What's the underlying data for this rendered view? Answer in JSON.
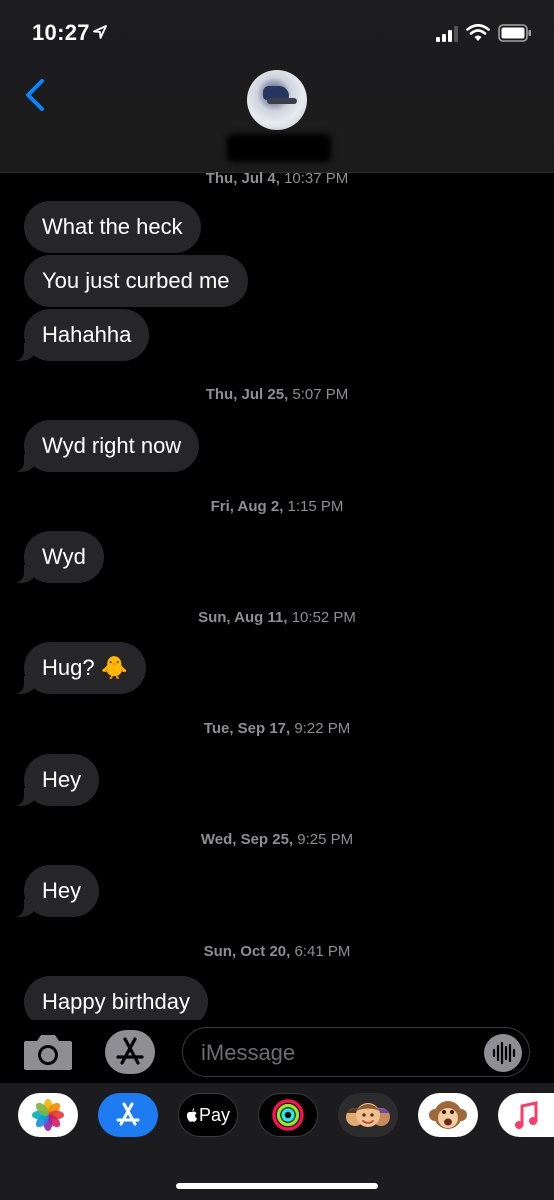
{
  "status_bar": {
    "time": "10:27",
    "icons": [
      "location-arrow-icon",
      "cellular-signal-icon",
      "wifi-icon",
      "battery-icon"
    ]
  },
  "header": {
    "back_icon": "chevron-left-icon",
    "avatar": "contact-avatar",
    "contact_name": ""
  },
  "thread": {
    "timestamp_top": {
      "day": "Thu, Jul 4,",
      "time": " 10:37 PM"
    },
    "messages": [
      {
        "text": "What the heck"
      },
      {
        "text": "You just curbed me"
      },
      {
        "text": "Hahahha"
      },
      {
        "timestamp": {
          "day": "Thu, Jul 25,",
          "time": " 5:07 PM"
        }
      },
      {
        "text": "Wyd right now"
      },
      {
        "timestamp": {
          "day": "Fri, Aug 2,",
          "time": " 1:15 PM"
        }
      },
      {
        "text": "Wyd"
      },
      {
        "timestamp": {
          "day": "Sun, Aug 11,",
          "time": " 10:52 PM"
        }
      },
      {
        "text": "Hug? 🐥"
      },
      {
        "timestamp": {
          "day": "Tue, Sep 17,",
          "time": " 9:22 PM"
        }
      },
      {
        "text": "Hey"
      },
      {
        "timestamp": {
          "day": "Wed, Sep 25,",
          "time": " 9:25 PM"
        }
      },
      {
        "text": "Hey"
      },
      {
        "timestamp": {
          "day": "Sun, Oct 20,",
          "time": " 6:41 PM"
        }
      },
      {
        "text": "Happy birthday"
      }
    ]
  },
  "composer": {
    "camera_icon": "camera-icon",
    "appstore_icon": "app-store-icon",
    "placeholder": "iMessage",
    "audio_icon": "audio-waveform-icon"
  },
  "app_drawer": {
    "apps": [
      {
        "name": "photos-app-icon",
        "label": ""
      },
      {
        "name": "app-store-app-icon",
        "label": ""
      },
      {
        "name": "apple-pay-app-icon",
        "label": "Pay"
      },
      {
        "name": "activity-app-icon",
        "label": ""
      },
      {
        "name": "memoji-app-icon",
        "label": ""
      },
      {
        "name": "animoji-monkey-app-icon",
        "label": ""
      },
      {
        "name": "music-app-icon",
        "label": ""
      }
    ]
  },
  "colors": {
    "bubble": "#262628",
    "accent_blue": "#0a84ff",
    "timestamp": "#8e8e93"
  }
}
